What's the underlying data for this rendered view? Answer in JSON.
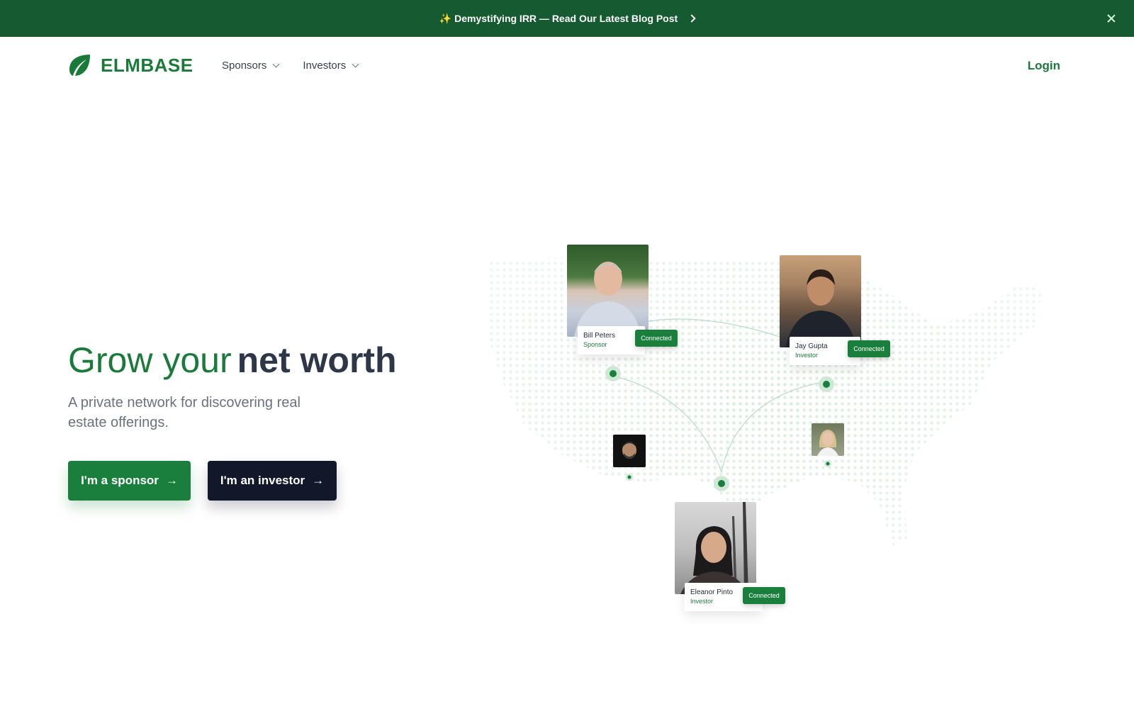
{
  "banner": {
    "text": "✨ Demystifying IRR — Read Our Latest Blog Post"
  },
  "nav": {
    "logo_text": "ELMBASE",
    "menu": [
      {
        "label": "Sponsors"
      },
      {
        "label": "Investors"
      }
    ],
    "login_label": "Login"
  },
  "hero": {
    "title_green": "Grow your",
    "title_dark": "net worth",
    "subtitle": "A private network for discovering real estate offerings.",
    "sponsor_button": "I'm a sponsor",
    "investor_button": "I'm an investor",
    "arrow": "→"
  },
  "network": {
    "connected_label": "Connected",
    "people": [
      {
        "name": "Bill Peters",
        "role": "Sponsor"
      },
      {
        "name": "Jay Gupta",
        "role": "Investor"
      },
      {
        "name": "Eleanor Pinto",
        "role": "Investor"
      }
    ]
  },
  "colors": {
    "brand_green": "#1a7a3a",
    "banner_bg": "#165a32",
    "dark_button": "#121829"
  }
}
